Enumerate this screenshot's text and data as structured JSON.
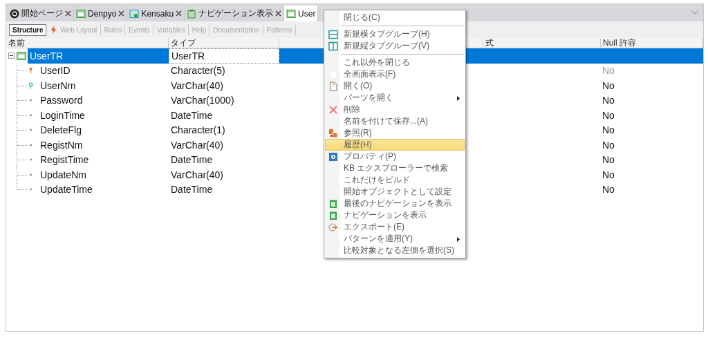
{
  "tabs": [
    {
      "label": "開始ページ",
      "kind": "gx",
      "selected": false
    },
    {
      "label": "Denpyo",
      "kind": "table",
      "selected": false
    },
    {
      "label": "Kensaku",
      "kind": "search-table",
      "selected": false
    },
    {
      "label": "ナビゲーション表示",
      "kind": "navigation",
      "selected": false
    },
    {
      "label": "User",
      "kind": "table",
      "selected": true
    }
  ],
  "toolbar": [
    {
      "label": "Structure",
      "selected": true,
      "disabled": false,
      "kind": "plain"
    },
    {
      "label": "Web Layout",
      "selected": false,
      "disabled": true,
      "kind": "web"
    },
    {
      "label": "Rules",
      "selected": false,
      "disabled": true,
      "kind": "plain"
    },
    {
      "label": "Events",
      "selected": false,
      "disabled": true,
      "kind": "plain"
    },
    {
      "label": "Variables",
      "selected": false,
      "disabled": true,
      "kind": "plain"
    },
    {
      "label": "Help",
      "selected": false,
      "disabled": true,
      "kind": "plain"
    },
    {
      "label": "Documentation",
      "selected": false,
      "disabled": true,
      "kind": "plain"
    },
    {
      "label": "Patterns",
      "selected": false,
      "disabled": true,
      "kind": "plain"
    }
  ],
  "columns": [
    "名前",
    "タイプ",
    "式",
    "Null 許容"
  ],
  "tree": {
    "name": "UserTR",
    "type": "UserTR",
    "kind": "transaction",
    "selected": true,
    "expanded": true,
    "children": [
      {
        "name": "UserID",
        "type": "Character(5)",
        "kind": "key",
        "selected": false,
        "null_allowed": "No",
        "null_greyed": true
      },
      {
        "name": "UserNm",
        "type": "VarChar(40)",
        "kind": "index",
        "selected": false,
        "null_allowed": "No",
        "null_greyed": false
      },
      {
        "name": "Password",
        "type": "VarChar(1000)",
        "kind": "attribute",
        "selected": false,
        "null_allowed": "No",
        "null_greyed": false
      },
      {
        "name": "LoginTime",
        "type": "DateTime",
        "kind": "attribute",
        "selected": false,
        "null_allowed": "No",
        "null_greyed": false
      },
      {
        "name": "DeleteFlg",
        "type": "Character(1)",
        "kind": "attribute",
        "selected": false,
        "null_allowed": "No",
        "null_greyed": false
      },
      {
        "name": "RegistNm",
        "type": "VarChar(40)",
        "kind": "attribute",
        "selected": false,
        "null_allowed": "No",
        "null_greyed": false
      },
      {
        "name": "RegistTime",
        "type": "DateTime",
        "kind": "attribute",
        "selected": false,
        "null_allowed": "No",
        "null_greyed": false
      },
      {
        "name": "UpdateNm",
        "type": "VarChar(40)",
        "kind": "attribute",
        "selected": false,
        "null_allowed": "No",
        "null_greyed": false
      },
      {
        "name": "UpdateTime",
        "type": "DateTime",
        "kind": "attribute",
        "selected": false,
        "null_allowed": "No",
        "null_greyed": false
      }
    ]
  },
  "context_menu": [
    {
      "label": "閉じる(C)",
      "kind": "plain",
      "submenu": false,
      "selected": false
    },
    {
      "kind": "separator"
    },
    {
      "label": "新規横タブグループ(H)",
      "kind": "hsplit",
      "submenu": false,
      "selected": false
    },
    {
      "label": "新規縦タブグループ(V)",
      "kind": "vsplit",
      "submenu": false,
      "selected": false
    },
    {
      "kind": "separator"
    },
    {
      "label": "これ以外を閉じる",
      "kind": "plain",
      "submenu": false,
      "selected": false
    },
    {
      "label": "全画面表示(F)",
      "kind": "blank",
      "submenu": false,
      "selected": false
    },
    {
      "label": "開く(O)",
      "kind": "document",
      "submenu": false,
      "selected": false
    },
    {
      "label": "パーツを開く",
      "kind": "plain",
      "submenu": true,
      "selected": false
    },
    {
      "label": "削除",
      "kind": "delete",
      "submenu": false,
      "selected": false
    },
    {
      "label": "名前を付けて保存...(A)",
      "kind": "plain",
      "submenu": false,
      "selected": false
    },
    {
      "label": "参照(R)",
      "kind": "reference",
      "submenu": false,
      "selected": false
    },
    {
      "label": "履歴(H)",
      "kind": "plain",
      "submenu": false,
      "selected": true
    },
    {
      "label": "プロパティ(P)",
      "kind": "gear",
      "submenu": false,
      "selected": false
    },
    {
      "label": "KB エクスプローラーで検索",
      "kind": "plain",
      "submenu": false,
      "selected": false
    },
    {
      "label": "これだけをビルド",
      "kind": "plain",
      "submenu": false,
      "selected": false
    },
    {
      "label": "開始オブジェクトとして設定",
      "kind": "plain",
      "submenu": false,
      "selected": false
    },
    {
      "label": "最後のナビゲーションを表示",
      "kind": "clipboard",
      "submenu": false,
      "selected": false
    },
    {
      "label": "ナビゲーションを表示",
      "kind": "clipboard",
      "submenu": false,
      "selected": false
    },
    {
      "label": "エクスポート(E)",
      "kind": "export",
      "submenu": false,
      "selected": false
    },
    {
      "label": "パターンを適用(Y)",
      "kind": "plain",
      "submenu": true,
      "selected": false
    },
    {
      "label": "比較対象となる左側を選択(S)",
      "kind": "plain",
      "submenu": false,
      "selected": false
    }
  ]
}
